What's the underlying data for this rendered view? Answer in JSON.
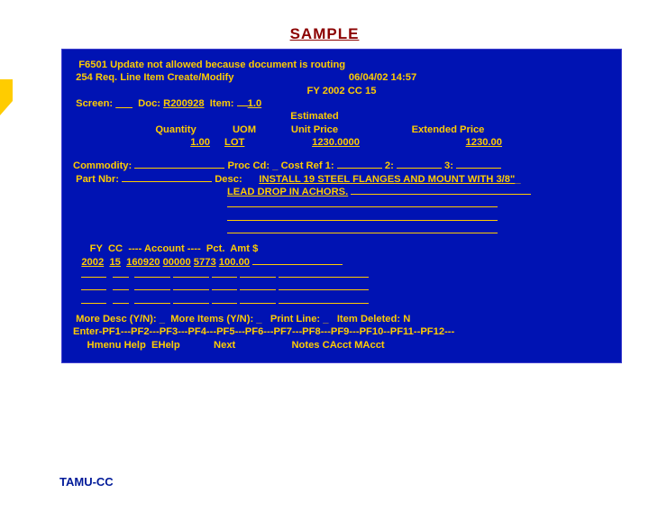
{
  "header": {
    "title": "SAMPLE"
  },
  "status": {
    "msg_code": "F6501",
    "msg_text": "Update not allowed because document is routing",
    "screen_id": "254",
    "screen_title": "Req. Line Item Create/Modify",
    "datetime": "06/04/02 14:57",
    "fy_line": "FY 2002 CC 15",
    "screen_field": "___",
    "doc": "R200928",
    "item": "1.0"
  },
  "cols": {
    "quantity": "Quantity",
    "uom": "UOM",
    "estimated": "Estimated",
    "unit_price": "Unit Price",
    "ext_price": "Extended Price"
  },
  "values": {
    "quantity": "1.00",
    "uom": "LOT",
    "unit_price": "1230.0000",
    "ext_price": "1230.00"
  },
  "labels": {
    "commodity": "Commodity:",
    "proc_cd": "Proc Cd:",
    "cost_ref1": "Cost Ref 1:",
    "two": "2:",
    "three": "3:",
    "part_nbr": "Part Nbr:",
    "desc": "Desc:",
    "acct_header": "FY  CC  ---- Account ----  Pct.  Amt $",
    "more_desc": "More Desc (Y/N):",
    "more_items": "More Items (Y/N):",
    "print_line": "Print Line:",
    "item_deleted": "Item Deleted:",
    "item_deleted_val": "N"
  },
  "desc": {
    "line1": "INSTALL 19 STEEL FLANGES AND MOUNT WITH 3/8\"",
    "line2": "LEAD DROP IN ACHORS."
  },
  "acct": {
    "fy": "2002",
    "cc": "15",
    "account1": "160920",
    "account2": "00000",
    "account3": "5773",
    "pct": "100.00"
  },
  "pfkeys": {
    "line1": "Enter-PF1---PF2---PF3---PF4---PF5---PF6---PF7---PF8---PF9---PF10--PF11--PF12---",
    "line2": "     Hmenu Help  EHelp            Next                    Notes CAcct MAcct"
  },
  "footer": {
    "org": "TAMU-CC"
  }
}
